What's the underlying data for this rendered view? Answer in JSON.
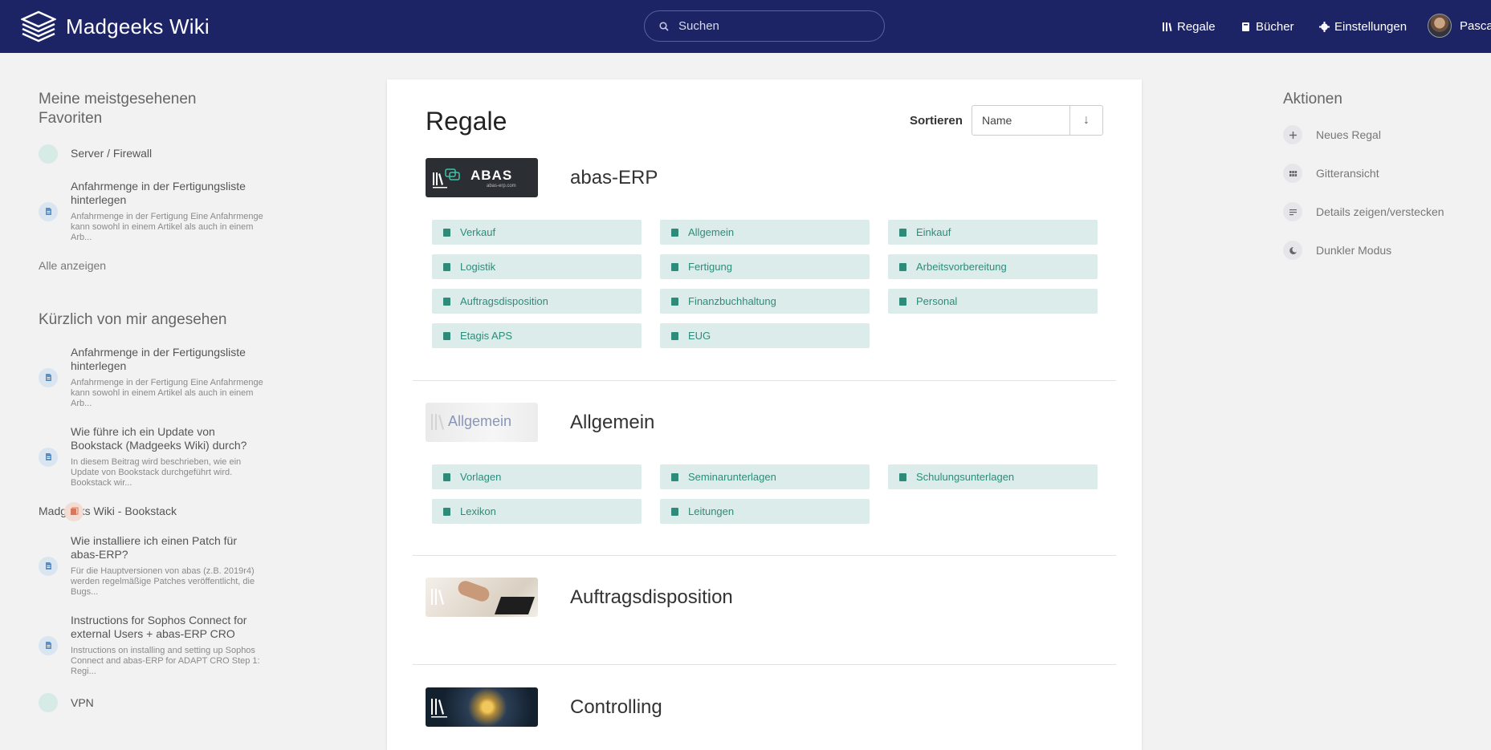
{
  "header": {
    "app_name": "Madgeeks Wiki",
    "search_placeholder": "Suchen",
    "nav": {
      "shelves": "Regale",
      "books": "Bücher",
      "settings": "Einstellungen"
    },
    "user_name": "Pascal",
    "colors": {
      "background": "#1c2466"
    }
  },
  "left": {
    "favorites_title": "Meine meistgesehenen Favoriten",
    "favorites": [
      {
        "type": "book",
        "title": "Server / Firewall",
        "desc": ""
      },
      {
        "type": "page",
        "title": "Anfahrmenge in der Fertigungsliste hinterlegen",
        "desc": "Anfahrmenge in der Fertigung Eine Anfahrmenge kann sowohl in einem Artikel als auch in einem Arb..."
      }
    ],
    "show_all": "Alle anzeigen",
    "recent_title": "Kürzlich von mir angesehen",
    "recent": [
      {
        "type": "page",
        "title": "Anfahrmenge in der Fertigungsliste hinterlegen",
        "desc": "Anfahrmenge in der Fertigung Eine Anfahrmenge kann sowohl in einem Artikel als auch in einem Arb..."
      },
      {
        "type": "page",
        "title": "Wie führe ich ein Update von Bookstack (Madgeeks Wiki) durch?",
        "desc": "In diesem Beitrag wird beschrieben, wie ein Update von Bookstack durchgeführt wird. Bookstack wir..."
      },
      {
        "type": "shelf",
        "title": "Madgeeks Wiki - Bookstack",
        "desc": ""
      },
      {
        "type": "page",
        "title": "Wie installiere ich einen Patch für abas-ERP?",
        "desc": "Für die Hauptversionen von abas (z.B. 2019r4) werden regelmäßige Patches veröffentlicht, die Bugs..."
      },
      {
        "type": "page",
        "title": "Instructions for Sophos Connect for external Users + abas-ERP CRO",
        "desc": "Instructions on installing and setting up Sophos Connect and abas-ERP for ADAPT CRO Step 1: Regi..."
      },
      {
        "type": "book",
        "title": "VPN",
        "desc": ""
      }
    ]
  },
  "main": {
    "title": "Regale",
    "sort_label": "Sortieren",
    "sort_value": "Name",
    "sort_dir": "↓",
    "shelves": [
      {
        "name": "abas-ERP",
        "thumb_text": "ABAS",
        "thumb_sub": "abas-erp.com",
        "books": [
          "Verkauf",
          "Allgemein",
          "Einkauf",
          "Logistik",
          "Fertigung",
          "Arbeitsvorbereitung",
          "Auftragsdisposition",
          "Finanzbuchhaltung",
          "Personal",
          "Etagis APS",
          "EUG"
        ]
      },
      {
        "name": "Allgemein",
        "thumb_text": "Allgemein",
        "books": [
          "Vorlagen",
          "Seminarunterlagen",
          "Schulungsunterlagen",
          "Lexikon",
          "Leitungen"
        ]
      },
      {
        "name": "Auftragsdisposition",
        "books": []
      },
      {
        "name": "Controlling",
        "books": []
      }
    ]
  },
  "right": {
    "title": "Aktionen",
    "actions": [
      "Neues Regal",
      "Gitteransicht",
      "Details zeigen/verstecken",
      "Dunkler Modus"
    ]
  }
}
